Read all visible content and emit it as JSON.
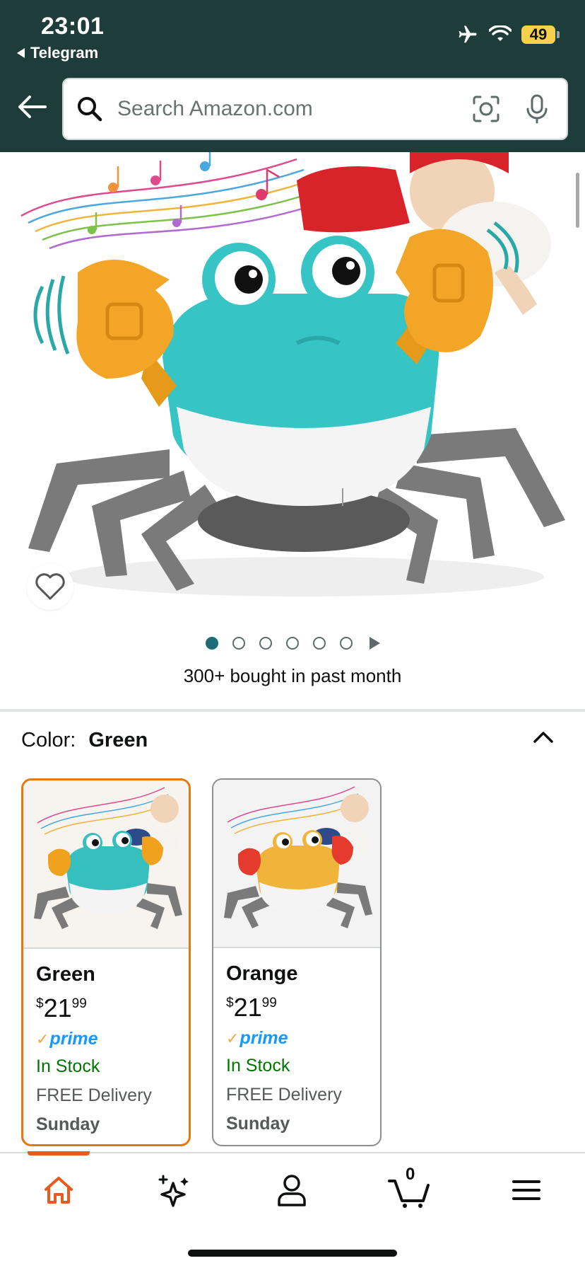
{
  "status_bar": {
    "time": "23:01",
    "back_app": "Telegram",
    "battery": "49"
  },
  "search": {
    "placeholder": "Search Amazon.com"
  },
  "product": {
    "bought_text": "300+ bought in past month",
    "image_count": 6,
    "active_image_index": 0
  },
  "color_selector": {
    "label": "Color:",
    "selected": "Green",
    "options": [
      {
        "name": "Green",
        "price_currency": "$",
        "price_whole": "21",
        "price_fraction": "99",
        "prime": "prime",
        "stock": "In Stock",
        "delivery": "FREE Delivery",
        "day": "Sunday",
        "body_color": "#36bfbf",
        "claw_color": "#f0a21e"
      },
      {
        "name": "Orange",
        "price_currency": "$",
        "price_whole": "21",
        "price_fraction": "99",
        "prime": "prime",
        "stock": "In Stock",
        "delivery": "FREE Delivery",
        "day": "Sunday",
        "body_color": "#f0b43a",
        "claw_color": "#e53a2e"
      }
    ]
  },
  "bottom_nav": {
    "cart_count": "0",
    "items": [
      "home",
      "ai-sparkle",
      "account",
      "cart",
      "menu"
    ]
  },
  "colors": {
    "header_bg": "#1e3d3a",
    "accent_orange": "#e47911",
    "prime_blue": "#1399ff",
    "stock_green": "#007600"
  }
}
